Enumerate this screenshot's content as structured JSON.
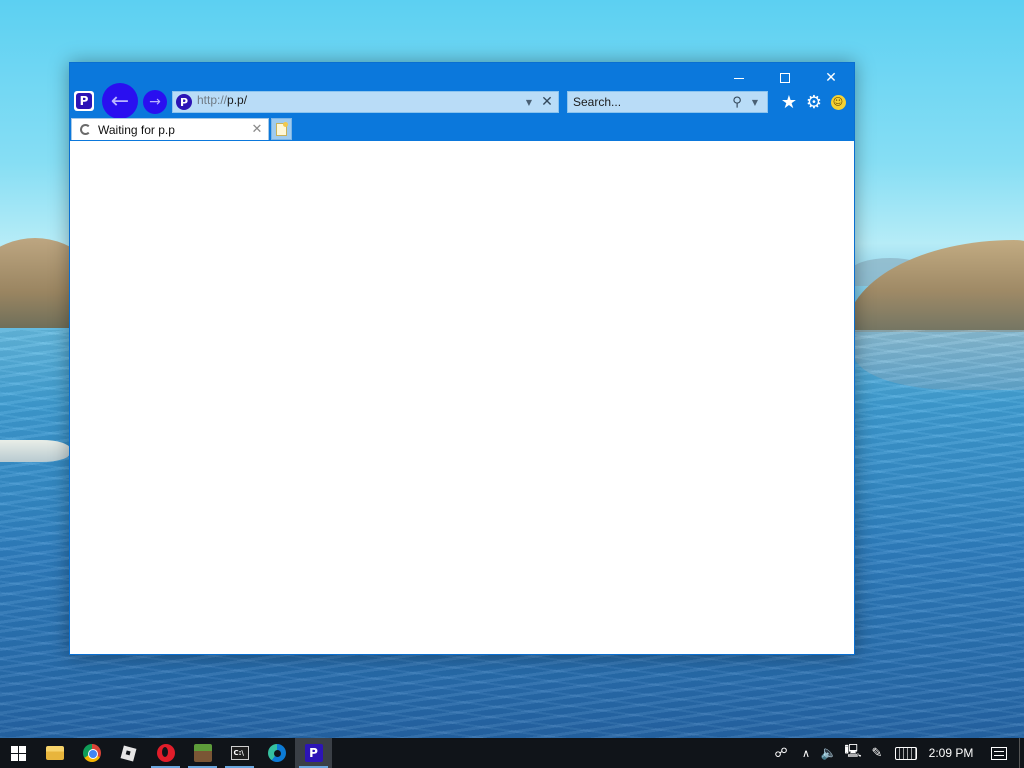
{
  "browser": {
    "caption": {
      "minimize": "minimize",
      "maximize": "maximize",
      "close": "close"
    },
    "logo_letter": "P",
    "site_icon_letter": "P",
    "address": {
      "scheme": "http://",
      "host": "p.p",
      "path": "/"
    },
    "search": {
      "placeholder": "Search..."
    },
    "tabs": [
      {
        "title": "Waiting for p.p",
        "loading": true
      }
    ],
    "colors": {
      "titlebar": "#0b78dc",
      "nav_buttons": "#2a0ff0",
      "address_bg": "#b9dcf7",
      "brand": "#2c14b6"
    }
  },
  "taskbar": {
    "apps": [
      {
        "name": "File Explorer",
        "icon": "folder-icon"
      },
      {
        "name": "Google Chrome",
        "icon": "chrome-icon"
      },
      {
        "name": "Roblox",
        "icon": "roblox-icon"
      },
      {
        "name": "Opera",
        "icon": "opera-icon"
      },
      {
        "name": "Minecraft",
        "icon": "minecraft-icon"
      },
      {
        "name": "Command Prompt",
        "icon": "cmd-icon",
        "label": "C:\\"
      },
      {
        "name": "Microsoft Edge",
        "icon": "edge-icon"
      },
      {
        "name": "P Browser",
        "icon": "p-browser-icon",
        "label": "P",
        "active": true
      }
    ],
    "tray": {
      "clock": "2:09 PM",
      "icons": [
        "people-icon",
        "chevron-up-icon",
        "volume-icon",
        "network-icon",
        "pen-icon",
        "keyboard-icon",
        "notifications-icon"
      ]
    }
  }
}
